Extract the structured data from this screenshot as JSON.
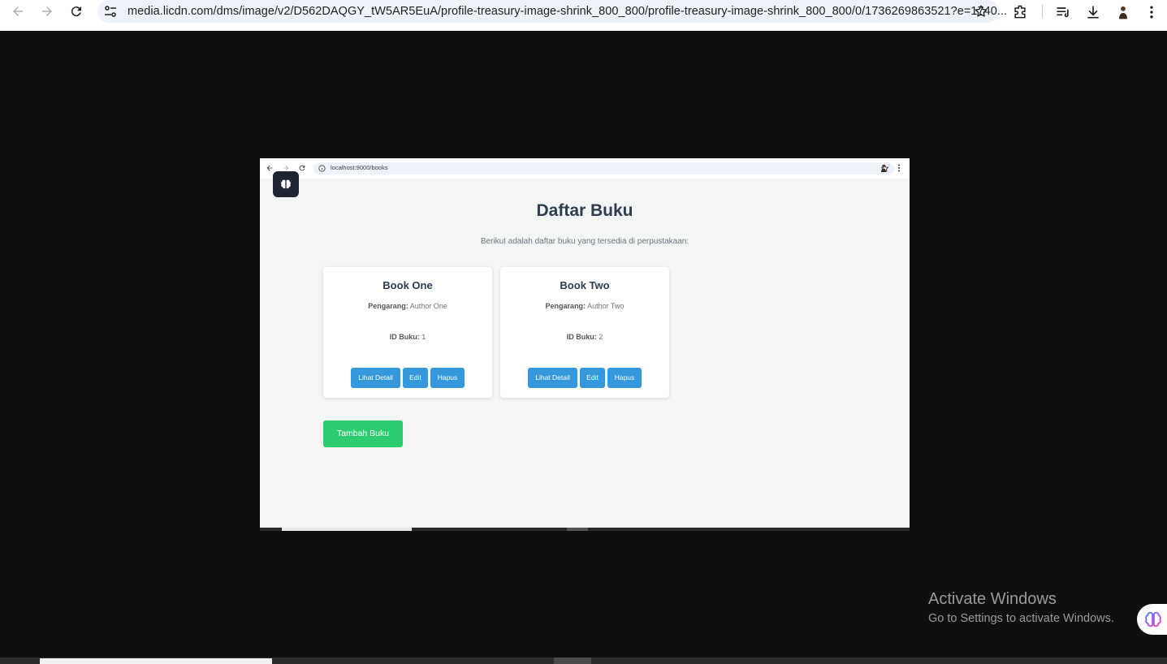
{
  "browser": {
    "url": "media.licdn.com/dms/image/v2/D562DAQGY_tW5AR5EuA/profile-treasury-image-shrink_800_800/profile-treasury-image-shrink_800_800/0/1736269863521?e=1740..."
  },
  "inner_browser": {
    "url": "localhost:9000/books"
  },
  "page": {
    "title": "Daftar Buku",
    "subtitle": "Berikut adalah daftar buku yang tersedia di perpustakaan:",
    "author_label": "Pengarang:",
    "id_label": "ID Buku:",
    "add_button": "Tambah Buku"
  },
  "books": [
    {
      "title": "Book One",
      "author": "Author One",
      "id": "1",
      "detail_label": "Lihat Detail",
      "edit_label": "Edit",
      "delete_label": "Hapus"
    },
    {
      "title": "Book Two",
      "author": "Author Two",
      "id": "2",
      "detail_label": "Lihat Detail",
      "edit_label": "Edit",
      "delete_label": "Hapus"
    }
  ],
  "watermark": {
    "title": "Activate Windows",
    "subtitle": "Go to Settings to activate Windows."
  },
  "colors": {
    "primary_button": "#3498db",
    "add_button": "#2ecc71",
    "heading": "#2c3e50"
  }
}
